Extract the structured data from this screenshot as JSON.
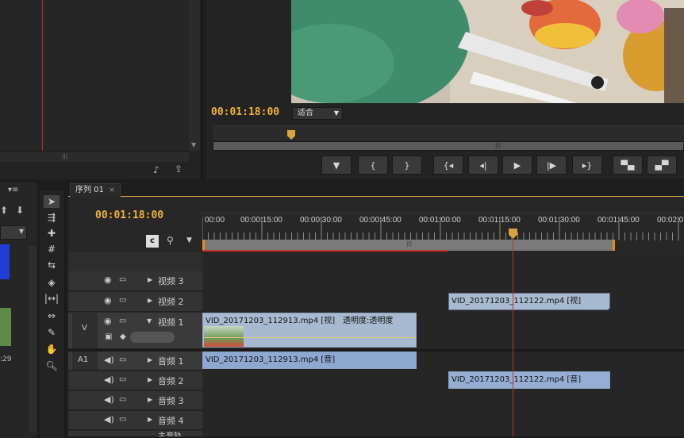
{
  "program": {
    "timecode": "00:01:18:00",
    "fit_label": "适合",
    "colors": {
      "timecode": "#f0b43a",
      "playhead": "#d8a440"
    }
  },
  "sequence": {
    "tab_label": "序列 01",
    "timecode": "00:01:18:00",
    "ruler": [
      "00:00",
      "00:00:15:00",
      "00:00:30:00",
      "00:00:45:00",
      "00:01:00:00",
      "00:01:15:00",
      "00:01:30:00",
      "00:01:45:00",
      "00:02:0"
    ],
    "tracks": {
      "v3": "视频 3",
      "v2": "视频 2",
      "v1": "视频 1",
      "v_label": "V",
      "a1": "音频 1",
      "a1_label": "A1",
      "a2": "音频 2",
      "a3": "音频 3",
      "a4": "音频 4",
      "master": "主音轨"
    },
    "clips": {
      "v2_clip": "VID_20171203_112122.mp4 [视]",
      "v1_clip": "VID_20171203_112913.mp4 [视]",
      "v1_opacity": "透明度:透明度",
      "a1_clip": "VID_20171203_112913.mp4 [音]",
      "a2_clip": "VID_20171203_112122.mp4 [音]"
    }
  },
  "project": {
    "time_label": ":29"
  },
  "icons": [
    "eye-icon",
    "film-icon",
    "speaker-icon",
    "triangle-right-icon",
    "triangle-down-icon",
    "selection-tool-icon",
    "razor-tool-icon",
    "pen-tool-icon",
    "hand-tool-icon",
    "zoom-tool-icon",
    "play-icon",
    "step-back-icon",
    "step-forward-icon",
    "marker-icon"
  ]
}
